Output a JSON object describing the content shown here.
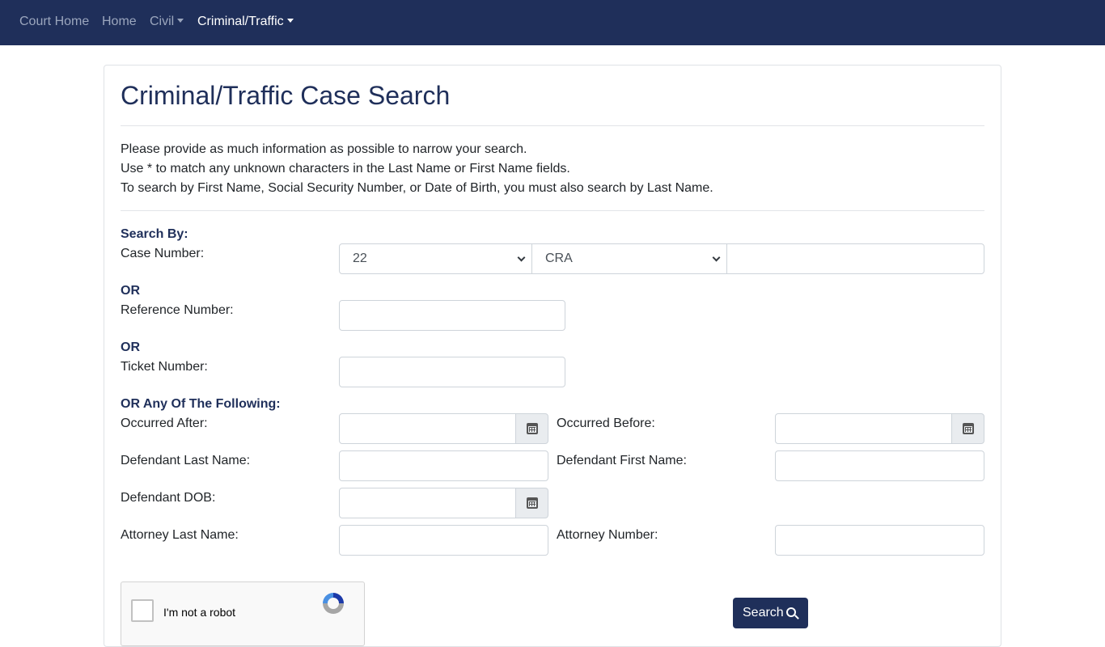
{
  "nav": {
    "court_home": "Court Home",
    "home": "Home",
    "civil": "Civil",
    "criminal_traffic": "Criminal/Traffic"
  },
  "page": {
    "title": "Criminal/Traffic Case Search",
    "help": [
      "Please provide as much information as possible to narrow your search.",
      "Use * to match any unknown characters in the Last Name or First Name fields.",
      "To search by First Name, Social Security Number, or Date of Birth, you must also search by Last Name."
    ]
  },
  "form": {
    "search_by": "Search By:",
    "case_number_label": "Case Number:",
    "case_year": "22",
    "case_type": "CRA",
    "case_sequence": "",
    "or_1": "OR",
    "reference_number_label": "Reference Number:",
    "or_2": "OR",
    "ticket_number_label": "Ticket Number:",
    "or_any": "OR Any Of The Following:",
    "occurred_after_label": "Occurred After:",
    "occurred_before_label": "Occurred Before:",
    "def_last_label": "Defendant Last Name:",
    "def_first_label": "Defendant First Name:",
    "def_dob_label": "Defendant DOB:",
    "atty_last_label": "Attorney Last Name:",
    "atty_number_label": "Attorney Number:"
  },
  "recaptcha": {
    "label": "I'm not a robot"
  },
  "search_button": "Search"
}
